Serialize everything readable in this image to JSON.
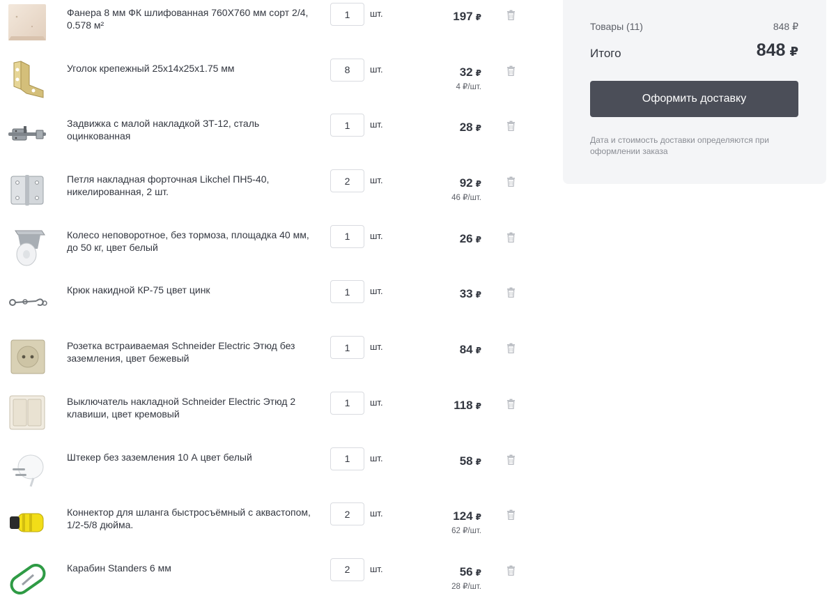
{
  "currency": "₽",
  "unit_label": "шт.",
  "items": [
    {
      "name": "Фанера 8 мм ФК шлифованная 760X760 мм сорт 2/4, 0.578 м²",
      "qty": "1",
      "price": "197",
      "per_unit": "",
      "icon": "plywood-icon"
    },
    {
      "name": "Уголок крепежный 25x14x25x1.75 мм",
      "qty": "8",
      "price": "32",
      "per_unit": "4 ₽/шт.",
      "icon": "bracket-icon"
    },
    {
      "name": "Задвижка с малой накладкой ЗТ-12, сталь оцинкованная",
      "qty": "1",
      "price": "28",
      "per_unit": "",
      "icon": "latch-icon"
    },
    {
      "name": "Петля накладная форточная Likchel ПН5-40, никелированная, 2 шт.",
      "qty": "2",
      "price": "92",
      "per_unit": "46 ₽/шт.",
      "icon": "hinge-icon"
    },
    {
      "name": "Колесо неповоротное, без тормоза, площадка 40 мм, до 50 кг, цвет белый",
      "qty": "1",
      "price": "26",
      "per_unit": "",
      "icon": "caster-wheel-icon"
    },
    {
      "name": "Крюк накидной КР-75 цвет цинк",
      "qty": "1",
      "price": "33",
      "per_unit": "",
      "icon": "hook-icon"
    },
    {
      "name": "Розетка встраиваемая Schneider Electric Этюд без заземления, цвет бежевый",
      "qty": "1",
      "price": "84",
      "per_unit": "",
      "icon": "socket-icon"
    },
    {
      "name": "Выключатель накладной Schneider Electric Этюд 2 клавиши, цвет кремовый",
      "qty": "1",
      "price": "118",
      "per_unit": "",
      "icon": "switch-icon"
    },
    {
      "name": "Штекер без заземления 10 А цвет белый",
      "qty": "1",
      "price": "58",
      "per_unit": "",
      "icon": "plug-icon"
    },
    {
      "name": "Коннектор для шланга быстросъёмный с аквастопом, 1/2-5/8 дюйма.",
      "qty": "2",
      "price": "124",
      "per_unit": "62 ₽/шт.",
      "icon": "hose-connector-icon"
    },
    {
      "name": "Карабин Standers 6 мм",
      "qty": "2",
      "price": "56",
      "per_unit": "28 ₽/шт.",
      "icon": "carabiner-icon"
    }
  ],
  "summary": {
    "goods_label": "Товары (11)",
    "goods_sum": "848 ₽",
    "total_label": "Итого",
    "total_sum": "848",
    "checkout_label": "Оформить доставку",
    "note": "Дата и стоимость доставки определяются при оформлении заказа"
  },
  "colors": {
    "text": "#333740",
    "button_bg": "#4b4e58",
    "panel_bg": "#f4f5f7",
    "muted": "#8a8d94"
  }
}
